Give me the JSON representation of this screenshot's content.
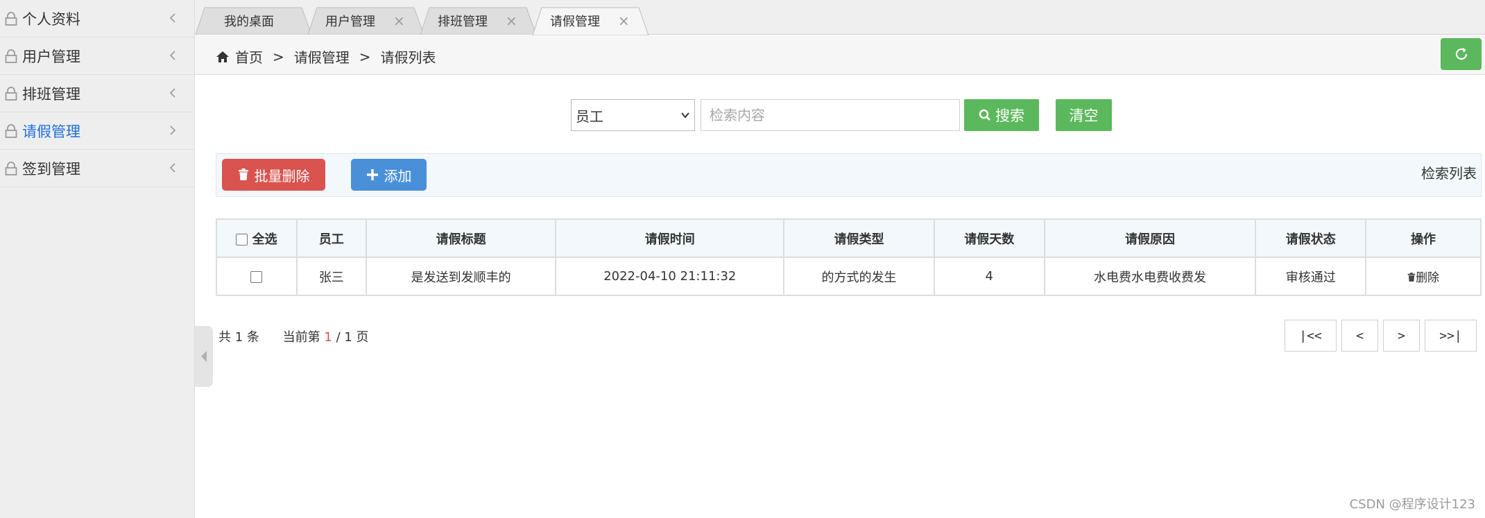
{
  "sidebar": {
    "items": [
      {
        "label": "个人资料"
      },
      {
        "label": "用户管理"
      },
      {
        "label": "排班管理"
      },
      {
        "label": "请假管理"
      },
      {
        "label": "签到管理"
      }
    ]
  },
  "tabs": [
    {
      "label": "我的桌面"
    },
    {
      "label": "用户管理",
      "close": "×"
    },
    {
      "label": "排班管理",
      "close": "×"
    },
    {
      "label": "请假管理",
      "close": "×"
    }
  ],
  "breadcrumb": {
    "home": "首页",
    "sep": ">",
    "level1": "请假管理",
    "level2": "请假列表"
  },
  "search": {
    "field_selected": "员工",
    "placeholder": "检索内容",
    "search_label": "搜索",
    "clear_label": "清空"
  },
  "actions": {
    "batch_delete_label": "批量删除",
    "add_label": "添加",
    "panel_title": "检索列表"
  },
  "table": {
    "headers": {
      "select_all": "全选",
      "employee": "员工",
      "title": "请假标题",
      "time": "请假时间",
      "type": "请假类型",
      "days": "请假天数",
      "reason": "请假原因",
      "status": "请假状态",
      "ops": "操作"
    },
    "rows": [
      {
        "employee": "张三",
        "title": "是发送到发顺丰的",
        "time": "2022-04-10 21:11:32",
        "type": "的方式的发生",
        "days": "4",
        "reason": "水电费水电费收费发",
        "status": "审核通过",
        "delete": "删除"
      }
    ]
  },
  "pagination": {
    "total_prefix": "共",
    "total": "1",
    "total_suffix": "条",
    "current_prefix": "当前第",
    "current": "1",
    "pages": "/ 1 页",
    "first": "|<<",
    "prev": "<",
    "next": ">",
    "last": ">>|"
  },
  "watermark": "CSDN @程序设计123",
  "colors": {
    "green": "#5cb85c",
    "red": "#d9534f",
    "blue": "#4a90d9",
    "active_link": "#1e6fd8"
  }
}
